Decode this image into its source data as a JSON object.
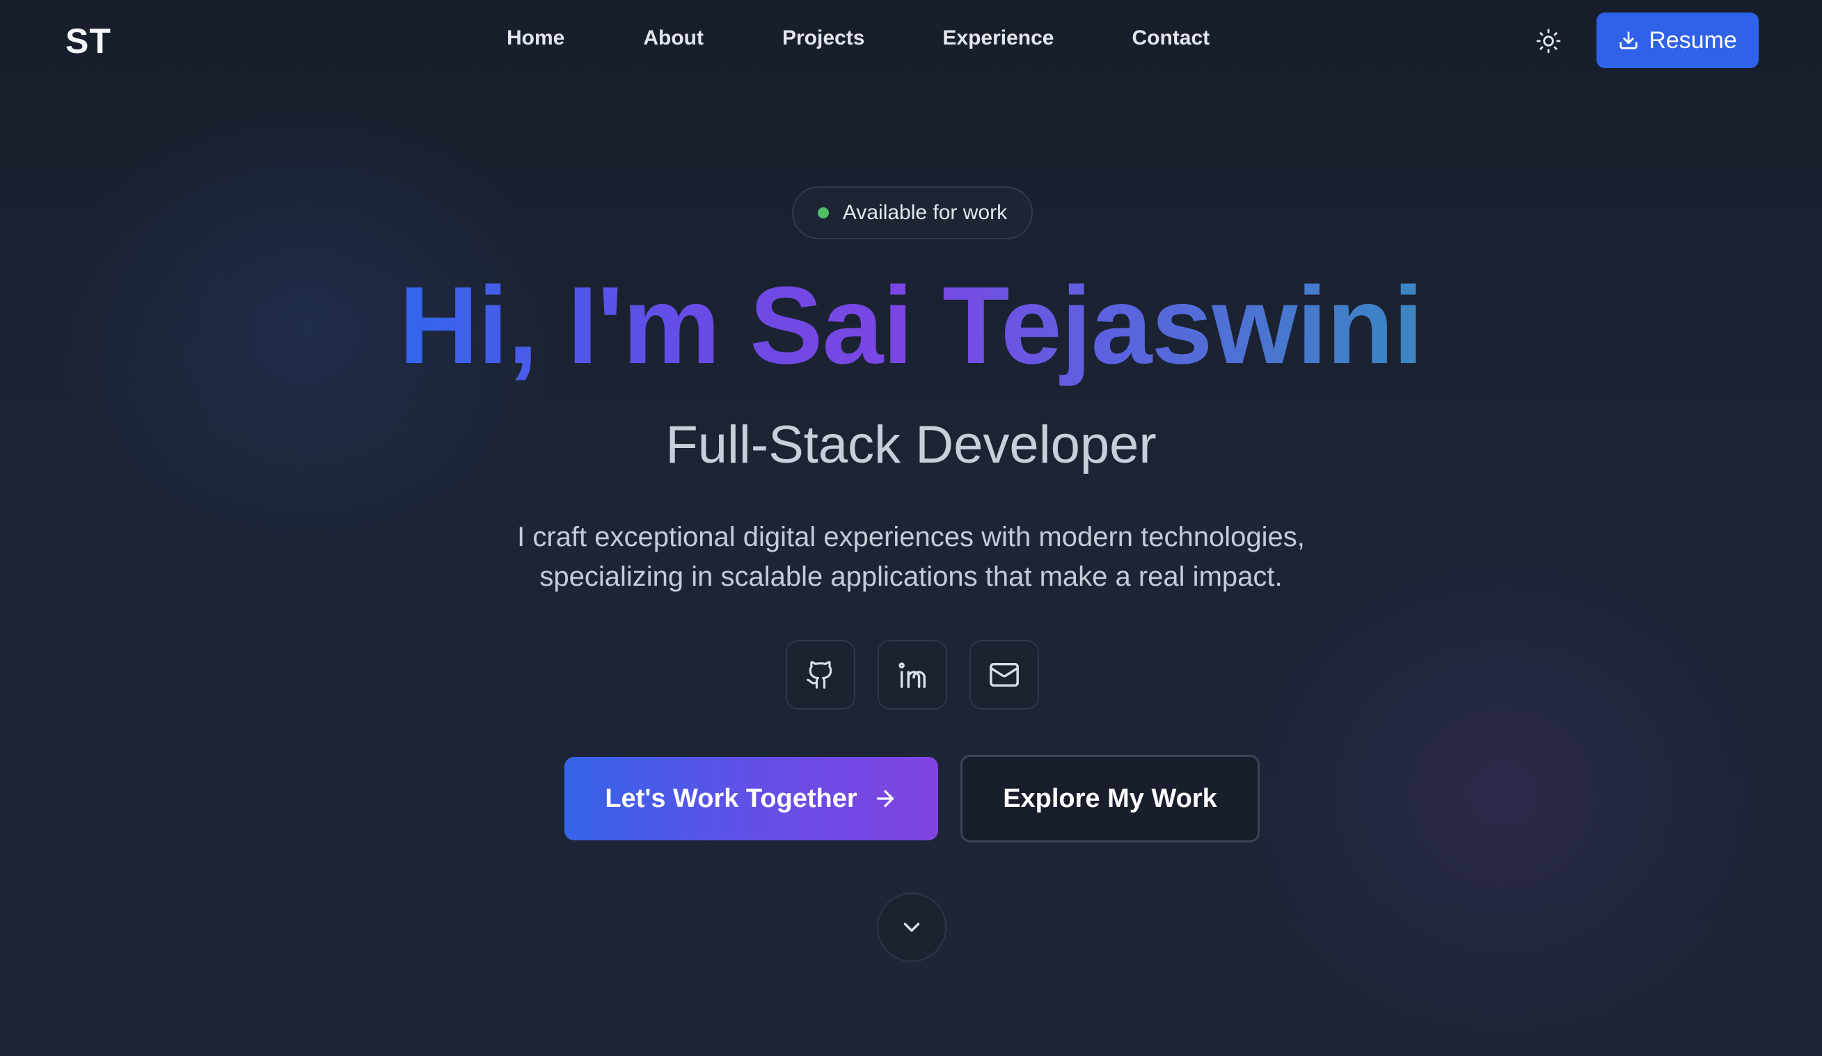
{
  "nav": {
    "logo": "ST",
    "links": [
      {
        "label": "Home"
      },
      {
        "label": "About"
      },
      {
        "label": "Projects"
      },
      {
        "label": "Experience"
      },
      {
        "label": "Contact"
      }
    ],
    "theme_toggle_icon": "sun-icon",
    "resume_label": "Resume",
    "resume_icon": "download-icon"
  },
  "hero": {
    "badge": "Available for work",
    "headline": "Hi, I'm Sai Tejaswini",
    "subtitle": "Full-Stack Developer",
    "description_line1": "I craft exceptional digital experiences with modern technologies,",
    "description_line2": "specializing in scalable applications that make a real impact.",
    "social": [
      {
        "icon": "github-icon"
      },
      {
        "icon": "linkedin-icon"
      },
      {
        "icon": "mail-icon"
      }
    ],
    "primary_cta": "Let's Work Together",
    "secondary_cta": "Explore My Work",
    "scroll_icon": "chevron-down-icon"
  },
  "colors": {
    "background": "#1b2231",
    "accent_blue": "#2f62e8",
    "accent_purple": "#7c46e3",
    "status_green": "#4ec06a"
  }
}
